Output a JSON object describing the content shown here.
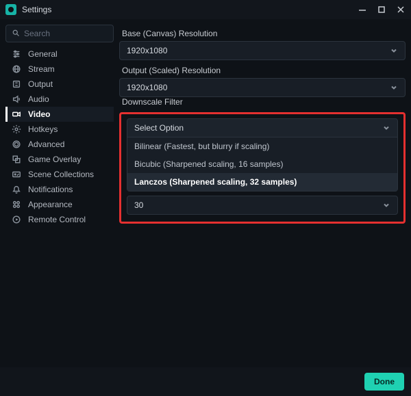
{
  "window": {
    "title": "Settings"
  },
  "search": {
    "placeholder": "Search"
  },
  "sidebar": {
    "items": [
      {
        "label": "General"
      },
      {
        "label": "Stream"
      },
      {
        "label": "Output"
      },
      {
        "label": "Audio"
      },
      {
        "label": "Video"
      },
      {
        "label": "Hotkeys"
      },
      {
        "label": "Advanced"
      },
      {
        "label": "Game Overlay"
      },
      {
        "label": "Scene Collections"
      },
      {
        "label": "Notifications"
      },
      {
        "label": "Appearance"
      },
      {
        "label": "Remote Control"
      }
    ]
  },
  "main": {
    "base_res_label": "Base (Canvas) Resolution",
    "base_res_value": "1920x1080",
    "output_res_label": "Output (Scaled) Resolution",
    "output_res_value": "1920x1080",
    "downscale_label_cut": "Downscale Filter",
    "downscale_placeholder": "Select Option",
    "downscale_options": [
      "Bilinear (Fastest, but blurry if scaling)",
      "Bicubic (Sharpened scaling, 16 samples)",
      "Lanczos (Sharpened scaling, 32 samples)"
    ],
    "fps_value": "30"
  },
  "footer": {
    "done": "Done"
  }
}
